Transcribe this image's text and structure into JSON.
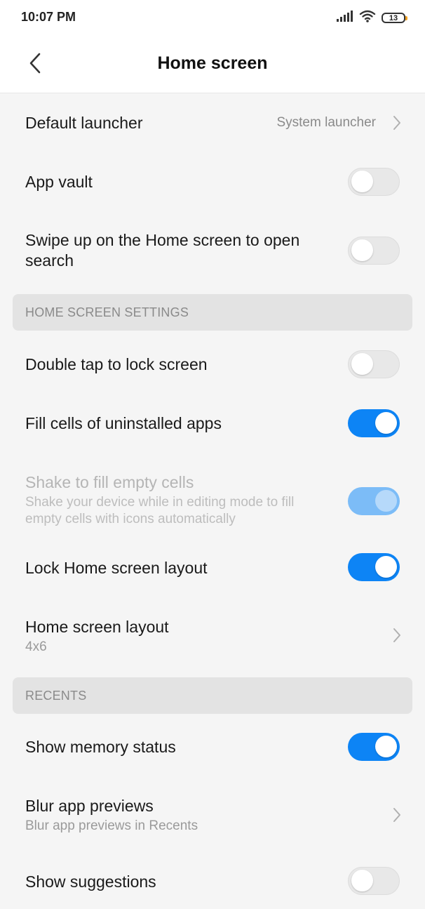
{
  "status_bar": {
    "time": "10:07 PM",
    "battery": "13"
  },
  "header": {
    "title": "Home screen"
  },
  "rows": {
    "default_launcher": {
      "title": "Default launcher",
      "value": "System launcher"
    },
    "app_vault": {
      "title": "App vault",
      "toggle": "off"
    },
    "swipe_up": {
      "title_line1": "Swipe up on the Home screen to open",
      "title_line2": "search",
      "toggle": "off"
    },
    "double_tap": {
      "title": "Double tap to lock screen",
      "toggle": "off"
    },
    "fill_cells": {
      "title": "Fill cells of uninstalled apps",
      "toggle": "on"
    },
    "shake_fill": {
      "title": "Shake to fill empty cells",
      "subtitle_line1": "Shake your device while in editing mode to fill",
      "subtitle_line2": "empty cells with icons automatically",
      "toggle": "on",
      "enabled": false
    },
    "lock_layout": {
      "title": "Lock Home screen layout",
      "toggle": "on"
    },
    "layout": {
      "title": "Home screen layout",
      "subtitle": "4x6"
    },
    "memory_status": {
      "title": "Show memory status",
      "toggle": "on"
    },
    "blur_previews": {
      "title": "Blur app previews",
      "subtitle": "Blur app previews in Recents"
    },
    "suggestions": {
      "title": "Show suggestions",
      "toggle": "off"
    }
  },
  "sections": {
    "home_screen_settings": "HOME SCREEN SETTINGS",
    "recents": "RECENTS"
  },
  "icons": {
    "back": "back-arrow-icon",
    "chevron": "chevron-right-icon",
    "signal": "signal-icon",
    "wifi": "wifi-icon",
    "battery": "battery-icon"
  },
  "colors": {
    "accent": "#0d84f5",
    "accent_disabled": "#7cbcf7",
    "section_bg": "#e3e3e3",
    "page_bg": "#f5f5f5"
  }
}
